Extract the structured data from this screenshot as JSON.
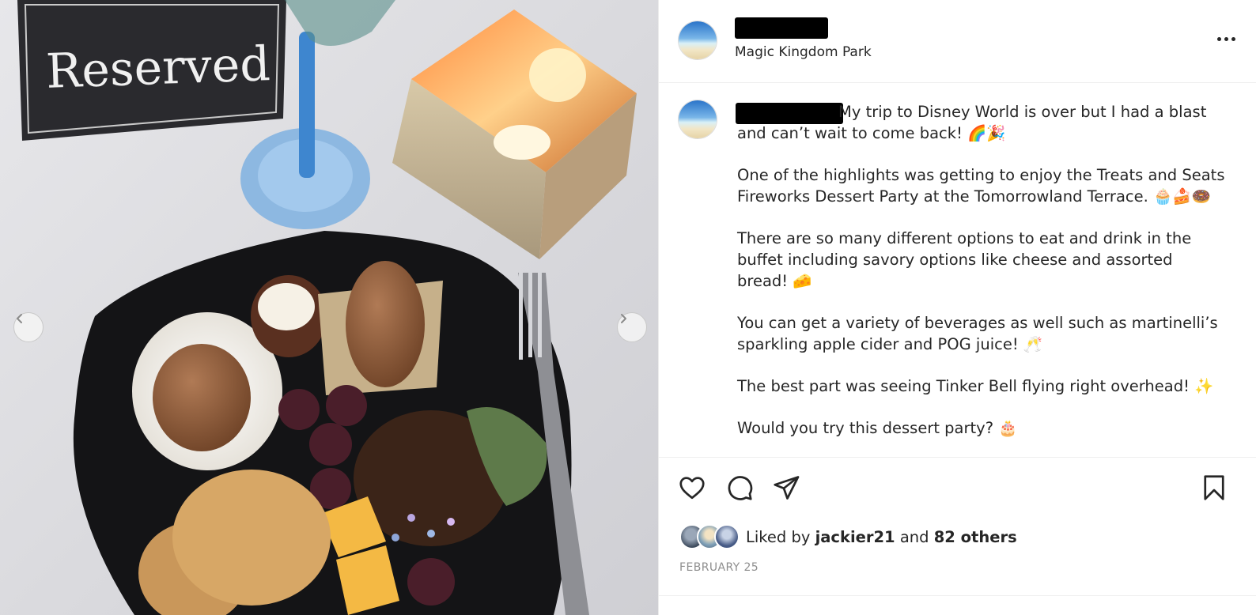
{
  "post": {
    "location": "Magic Kingdom Park",
    "photo_sign_text": "Reserved",
    "caption": [
      "My trip to Disney World is over but I had a blast and can’t wait to come back! 🌈🎉",
      "One of the highlights was getting to enjoy the Treats and Seats Fireworks Dessert Party at the Tomorrowland Terrace. 🧁🍰🍩",
      "There are so many different options to eat and drink in the buffet including savory options like cheese and assorted bread! 🧀",
      "You can get a variety of beverages as well such as martinelli’s sparkling apple cider and POG juice! 🥂",
      "The best part was seeing Tinker Bell flying right overhead! ✨",
      "Would you try this dessert party? 🎂"
    ],
    "likes": {
      "prefix": "Liked by",
      "user": "jackier21",
      "joiner": "and",
      "others": "82 others"
    },
    "date": "FEBRUARY 25"
  },
  "icons": {
    "prev": "chevron-left-icon",
    "next": "chevron-right-icon",
    "more": "more-horizontal-icon",
    "like": "heart-icon",
    "comment": "comment-icon",
    "share": "paper-plane-icon",
    "save": "bookmark-icon"
  }
}
